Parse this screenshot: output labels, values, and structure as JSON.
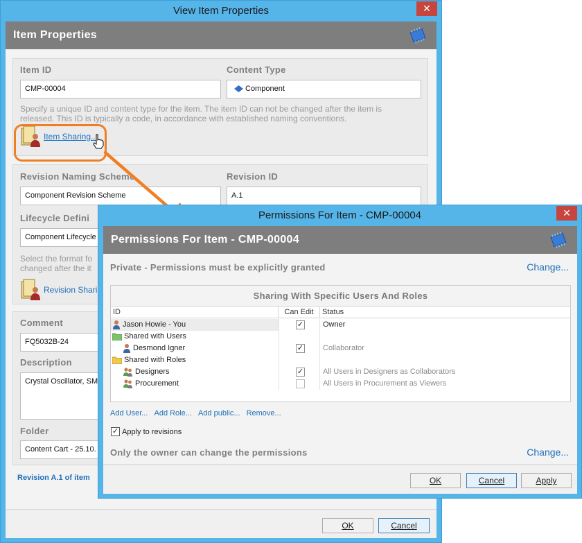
{
  "item_window": {
    "title": "View Item Properties",
    "close_glyph": "✕",
    "header": "Item Properties",
    "item_id_label": "Item ID",
    "item_id_value": "CMP-00004",
    "content_type_label": "Content Type",
    "content_type_value": "Component",
    "id_hint_line1": "Specify a unique ID and content type for the item. The item ID can not be changed after the item is",
    "id_hint_line2": "released. This ID is typically a code, in accordance with established naming conventions.",
    "item_sharing_link": "Item Sharing...",
    "revision_scheme_label": "Revision Naming Scheme",
    "revision_scheme_value": "Component Revision Scheme",
    "revision_id_label": "Revision ID",
    "revision_id_value": "A.1",
    "lifecycle_label": "Lifecycle Defini",
    "lifecycle_value": "Component Lifecycle",
    "lifecycle_hint_line1": "Select the format fo",
    "lifecycle_hint_line2": "changed after the it",
    "revision_sharing_link": "Revision Sharin",
    "comment_label": "Comment",
    "comment_value": "FQ5032B-24",
    "description_label": "Description",
    "description_value": "Crystal Oscillator, SMD",
    "folder_label": "Folder",
    "folder_value": "Content Cart - 25.10.",
    "footer_status": "Revision A.1 of item",
    "ok_label": "OK",
    "cancel_label": "Cancel"
  },
  "permissions_window": {
    "title": "Permissions For Item - CMP-00004",
    "close_glyph": "✕",
    "header": "Permissions For Item - CMP-00004",
    "privacy_text": "Private - Permissions must be explicitly granted",
    "change_link_top": "Change...",
    "grid_title": "Sharing With Specific Users And Roles",
    "columns": [
      "ID",
      "Can Edit",
      "Status"
    ],
    "rows": [
      {
        "id": "Jason Howie - You",
        "status": "Owner",
        "checked": true
      },
      {
        "id": "Shared with Users",
        "status": "",
        "checked": null
      },
      {
        "id": "Desmond Igner",
        "status": "Collaborator",
        "checked": true
      },
      {
        "id": "Shared with Roles",
        "status": "",
        "checked": null
      },
      {
        "id": "Designers",
        "status": "All Users in Designers as Collaborators",
        "checked": true
      },
      {
        "id": "Procurement",
        "status": "All Users in Procurement as Viewers",
        "checked": false
      }
    ],
    "actions": [
      "Add User...",
      "Add Role...",
      "Add public...",
      "Remove..."
    ],
    "apply_to_revisions_label": "Apply to revisions",
    "owner_note": "Only the owner can change the permissions",
    "change_link_bottom": "Change...",
    "ok_label": "OK",
    "cancel_label": "Cancel",
    "apply_label": "Apply"
  },
  "colors": {
    "window_frame": "#55b4e8",
    "header_band": "#7e7e7e",
    "callout": "#f07f24",
    "link": "#1a73c2",
    "close_button": "#c7453d"
  }
}
